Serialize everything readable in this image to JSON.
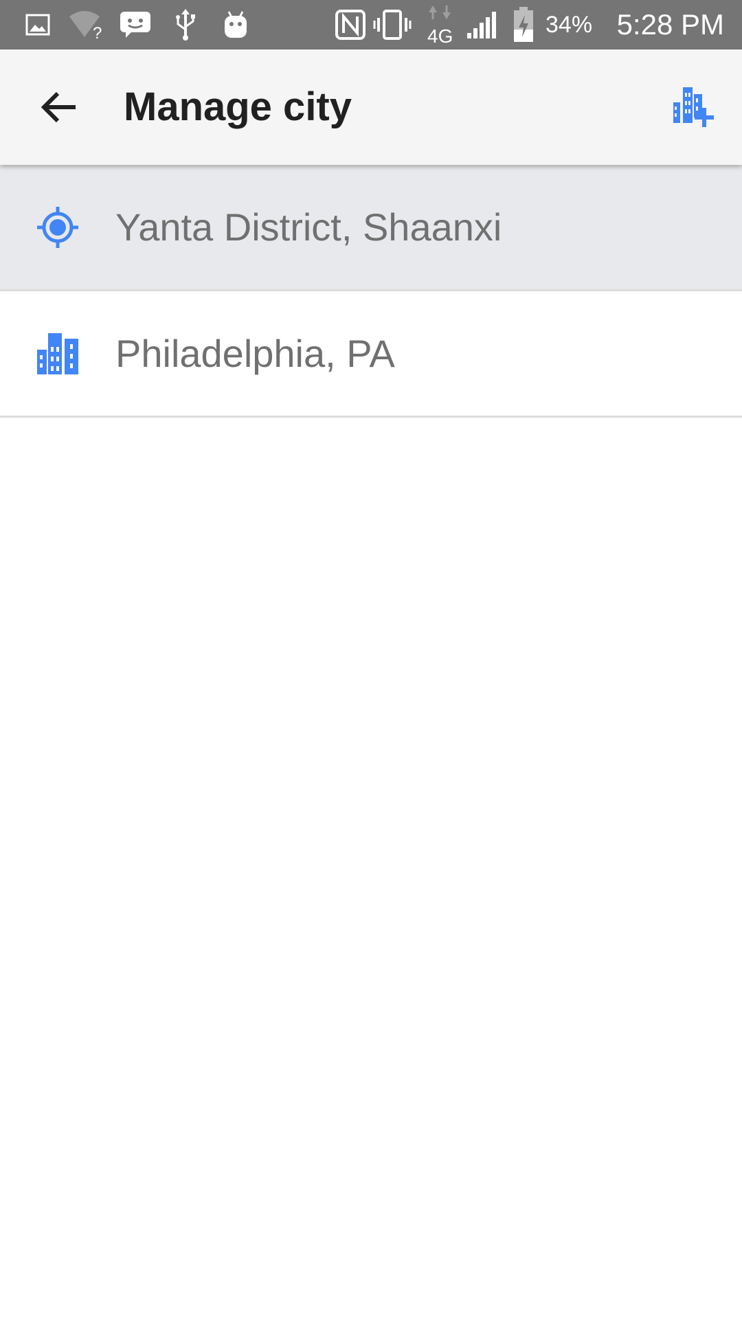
{
  "status_bar": {
    "battery_percent": "34%",
    "time": "5:28 PM",
    "network_type": "4G",
    "icons": [
      "gallery-icon",
      "wifi-unknown-icon",
      "messenger-icon",
      "usb-icon",
      "android-icon",
      "nfc-icon",
      "vibrate-icon",
      "mobile-data-icon",
      "signal-icon",
      "battery-charging-icon"
    ]
  },
  "app_bar": {
    "title": "Manage city",
    "back_icon": "arrow-back-icon",
    "add_icon": "add-city-icon"
  },
  "cities": [
    {
      "name": "Yanta District, Shaanxi",
      "icon": "location-target-icon",
      "selected": true
    },
    {
      "name": "Philadelphia, PA",
      "icon": "city-buildings-icon",
      "selected": false
    }
  ],
  "colors": {
    "accent": "#4285f4",
    "status_bar": "#757575",
    "app_bar": "#f5f5f5",
    "selected_row": "#e8e9ec",
    "city_text": "#707070",
    "title_text": "#212121"
  }
}
